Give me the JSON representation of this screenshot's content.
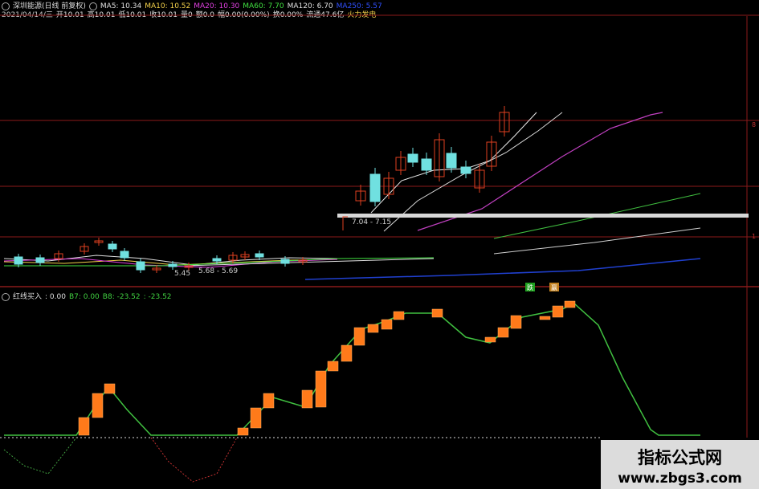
{
  "header": {
    "stock_title": "深圳能源(日线 前复权)",
    "ma": [
      {
        "label": "MA5: 10.34",
        "color": "#e0e0e0"
      },
      {
        "label": "MA10: 10.52",
        "color": "#f5d24a"
      },
      {
        "label": "MA20: 10.30",
        "color": "#e040e0"
      },
      {
        "label": "MA60: 7.70",
        "color": "#40e040"
      },
      {
        "label": "MA120: 6.70",
        "color": "#e0e0e0"
      },
      {
        "label": "MA250: 5.57",
        "color": "#3050ff"
      }
    ],
    "info": [
      {
        "label": "2021/04/14/三",
        "color": "#cccccc"
      },
      {
        "label": "开10.01",
        "color": "#e0e0e0"
      },
      {
        "label": "高10.01",
        "color": "#e0e0e0"
      },
      {
        "label": "低10.01",
        "color": "#e0e0e0"
      },
      {
        "label": "收10.01",
        "color": "#e0e0e0"
      },
      {
        "label": "量0",
        "color": "#e0e0e0"
      },
      {
        "label": "额0.0",
        "color": "#e0e0e0"
      },
      {
        "label": "幅0.00(0.00%)",
        "color": "#e0e0e0"
      },
      {
        "label": "换0.00%",
        "color": "#e0e0e0"
      },
      {
        "label": "流通47.6亿",
        "color": "#e0e0e0"
      },
      {
        "label": "火力发电",
        "color": "#f5d24a"
      }
    ]
  },
  "price_chart": {
    "annotations": {
      "low_left": "5.45",
      "low_mid": "5.68 - 5.69",
      "gap": "7.04 - 7.15"
    },
    "axis_labels": [
      "8",
      "1"
    ]
  },
  "indicator": {
    "title": "红线买入",
    "values": [
      {
        "label": ": 0.00",
        "color": "#e0e0e0"
      },
      {
        "label": "B7: 0.00",
        "color": "#40d040"
      },
      {
        "label": "B8: -23.52",
        "color": "#40d040"
      },
      {
        "label": ": -23.52",
        "color": "#40d040"
      }
    ],
    "markers": [
      "跌",
      "赢"
    ]
  },
  "chart_data": {
    "type": "line",
    "title": "红线买入",
    "series": [
      {
        "name": "B8",
        "values": [
          -23.52
        ]
      }
    ]
  },
  "watermark": {
    "title": "指标公式网",
    "url": "www.zbgs3.com"
  },
  "colors": {
    "background": "#000000",
    "up_candle": "#e04020",
    "down_candle": "#70e0e0",
    "indicator_line": "#40c040",
    "indicator_bar": "#ff7a1a",
    "divider": "#8b1a1a"
  }
}
